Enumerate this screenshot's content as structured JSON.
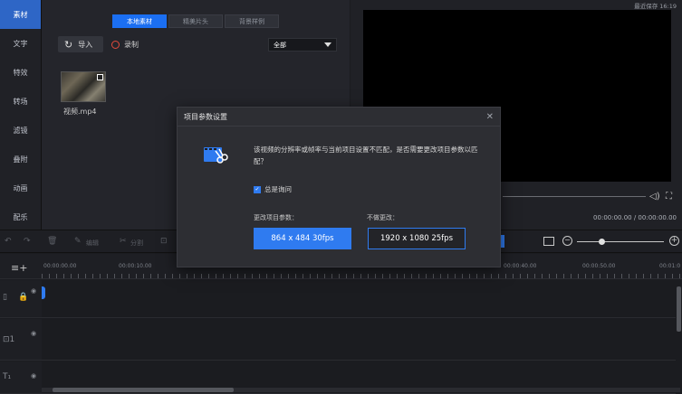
{
  "nav": {
    "items": [
      {
        "label": "素材",
        "active": true
      },
      {
        "label": "文字"
      },
      {
        "label": "特效"
      },
      {
        "label": "转场"
      },
      {
        "label": "滤镜"
      },
      {
        "label": "叠附"
      },
      {
        "label": "动画"
      },
      {
        "label": "配乐"
      }
    ]
  },
  "media": {
    "tabs": [
      "本地素材",
      "精美片头",
      "背景样例"
    ],
    "import_label": "导入",
    "record_label": "录制",
    "filter_value": "全部",
    "file_name": "视频.mp4"
  },
  "preview": {
    "saved_text": "最近保存 16:19",
    "timecode": "00:00:00.00 / 00:00:00.00"
  },
  "toolbar": {
    "edit_label": "编辑",
    "split_label": "分割"
  },
  "timeline": {
    "ruler_labels": [
      "00:00:00.00",
      "00:00:10.00",
      "00:00:40.00",
      "00:00:50.00",
      "00:01:0"
    ]
  },
  "dialog": {
    "title": "项目参数设置",
    "message": "该视频的分辨率或帧率与当前项目设置不匹配，是否需要更改项目参数以匹配？",
    "remember_label": "总是询问",
    "change_label": "更改项目参数：",
    "keep_label": "不做更改：",
    "change_button": "864 x 484 30fps",
    "keep_button": "1920 x 1080 25fps"
  },
  "colors": {
    "accent": "#2f7bf0",
    "background": "#1b1c20"
  }
}
